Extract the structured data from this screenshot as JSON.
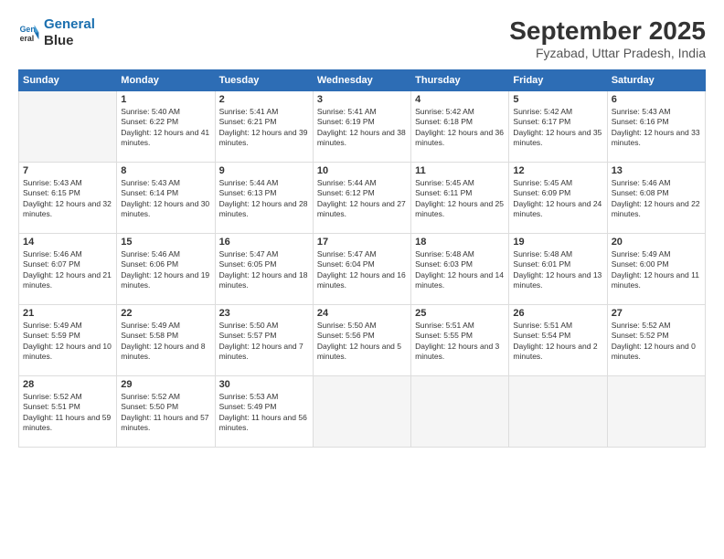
{
  "header": {
    "logo_line1": "General",
    "logo_line2": "Blue",
    "month": "September 2025",
    "location": "Fyzabad, Uttar Pradesh, India"
  },
  "weekdays": [
    "Sunday",
    "Monday",
    "Tuesday",
    "Wednesday",
    "Thursday",
    "Friday",
    "Saturday"
  ],
  "weeks": [
    [
      {
        "day": "",
        "empty": true
      },
      {
        "day": "1",
        "sunrise": "5:40 AM",
        "sunset": "6:22 PM",
        "daylight": "12 hours and 41 minutes."
      },
      {
        "day": "2",
        "sunrise": "5:41 AM",
        "sunset": "6:21 PM",
        "daylight": "12 hours and 39 minutes."
      },
      {
        "day": "3",
        "sunrise": "5:41 AM",
        "sunset": "6:19 PM",
        "daylight": "12 hours and 38 minutes."
      },
      {
        "day": "4",
        "sunrise": "5:42 AM",
        "sunset": "6:18 PM",
        "daylight": "12 hours and 36 minutes."
      },
      {
        "day": "5",
        "sunrise": "5:42 AM",
        "sunset": "6:17 PM",
        "daylight": "12 hours and 35 minutes."
      },
      {
        "day": "6",
        "sunrise": "5:43 AM",
        "sunset": "6:16 PM",
        "daylight": "12 hours and 33 minutes."
      }
    ],
    [
      {
        "day": "7",
        "sunrise": "5:43 AM",
        "sunset": "6:15 PM",
        "daylight": "12 hours and 32 minutes."
      },
      {
        "day": "8",
        "sunrise": "5:43 AM",
        "sunset": "6:14 PM",
        "daylight": "12 hours and 30 minutes."
      },
      {
        "day": "9",
        "sunrise": "5:44 AM",
        "sunset": "6:13 PM",
        "daylight": "12 hours and 28 minutes."
      },
      {
        "day": "10",
        "sunrise": "5:44 AM",
        "sunset": "6:12 PM",
        "daylight": "12 hours and 27 minutes."
      },
      {
        "day": "11",
        "sunrise": "5:45 AM",
        "sunset": "6:11 PM",
        "daylight": "12 hours and 25 minutes."
      },
      {
        "day": "12",
        "sunrise": "5:45 AM",
        "sunset": "6:09 PM",
        "daylight": "12 hours and 24 minutes."
      },
      {
        "day": "13",
        "sunrise": "5:46 AM",
        "sunset": "6:08 PM",
        "daylight": "12 hours and 22 minutes."
      }
    ],
    [
      {
        "day": "14",
        "sunrise": "5:46 AM",
        "sunset": "6:07 PM",
        "daylight": "12 hours and 21 minutes."
      },
      {
        "day": "15",
        "sunrise": "5:46 AM",
        "sunset": "6:06 PM",
        "daylight": "12 hours and 19 minutes."
      },
      {
        "day": "16",
        "sunrise": "5:47 AM",
        "sunset": "6:05 PM",
        "daylight": "12 hours and 18 minutes."
      },
      {
        "day": "17",
        "sunrise": "5:47 AM",
        "sunset": "6:04 PM",
        "daylight": "12 hours and 16 minutes."
      },
      {
        "day": "18",
        "sunrise": "5:48 AM",
        "sunset": "6:03 PM",
        "daylight": "12 hours and 14 minutes."
      },
      {
        "day": "19",
        "sunrise": "5:48 AM",
        "sunset": "6:01 PM",
        "daylight": "12 hours and 13 minutes."
      },
      {
        "day": "20",
        "sunrise": "5:49 AM",
        "sunset": "6:00 PM",
        "daylight": "12 hours and 11 minutes."
      }
    ],
    [
      {
        "day": "21",
        "sunrise": "5:49 AM",
        "sunset": "5:59 PM",
        "daylight": "12 hours and 10 minutes."
      },
      {
        "day": "22",
        "sunrise": "5:49 AM",
        "sunset": "5:58 PM",
        "daylight": "12 hours and 8 minutes."
      },
      {
        "day": "23",
        "sunrise": "5:50 AM",
        "sunset": "5:57 PM",
        "daylight": "12 hours and 7 minutes."
      },
      {
        "day": "24",
        "sunrise": "5:50 AM",
        "sunset": "5:56 PM",
        "daylight": "12 hours and 5 minutes."
      },
      {
        "day": "25",
        "sunrise": "5:51 AM",
        "sunset": "5:55 PM",
        "daylight": "12 hours and 3 minutes."
      },
      {
        "day": "26",
        "sunrise": "5:51 AM",
        "sunset": "5:54 PM",
        "daylight": "12 hours and 2 minutes."
      },
      {
        "day": "27",
        "sunrise": "5:52 AM",
        "sunset": "5:52 PM",
        "daylight": "12 hours and 0 minutes."
      }
    ],
    [
      {
        "day": "28",
        "sunrise": "5:52 AM",
        "sunset": "5:51 PM",
        "daylight": "11 hours and 59 minutes."
      },
      {
        "day": "29",
        "sunrise": "5:52 AM",
        "sunset": "5:50 PM",
        "daylight": "11 hours and 57 minutes."
      },
      {
        "day": "30",
        "sunrise": "5:53 AM",
        "sunset": "5:49 PM",
        "daylight": "11 hours and 56 minutes."
      },
      {
        "day": "",
        "empty": true
      },
      {
        "day": "",
        "empty": true
      },
      {
        "day": "",
        "empty": true
      },
      {
        "day": "",
        "empty": true
      }
    ]
  ]
}
